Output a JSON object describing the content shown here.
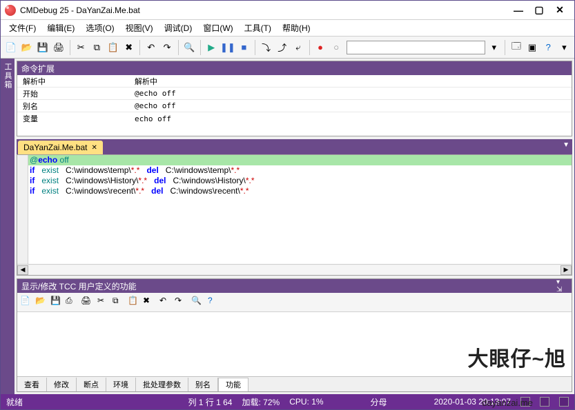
{
  "app": {
    "title": "CMDebug 25 - DaYanZai.Me.bat"
  },
  "menu": {
    "file": "文件(F)",
    "edit": "编辑(E)",
    "options": "选项(O)",
    "view": "视图(V)",
    "debug": "调试(D)",
    "window": "窗口(W)",
    "tools": "工具(T)",
    "help": "帮助(H)"
  },
  "toolbox_tab": "工具箱",
  "cmd_panel": {
    "title": "命令扩展",
    "rows": [
      {
        "k": "解析中",
        "v": "解析中"
      },
      {
        "k": "开始",
        "v": "@echo off"
      },
      {
        "k": "别名",
        "v": "@echo off"
      },
      {
        "k": "变量",
        "v": "echo off"
      }
    ]
  },
  "file_tab": {
    "name": "DaYanZai.Me.bat"
  },
  "code_lines": [
    {
      "hl": true,
      "tokens": [
        {
          "t": "@",
          "c": "kw-teal"
        },
        {
          "t": "echo",
          "c": "kw-blue"
        },
        {
          "t": " off",
          "c": "kw-teal"
        }
      ]
    },
    {
      "tokens": [
        {
          "t": "if",
          "c": "kw-blue"
        },
        {
          "t": "   ",
          "c": ""
        },
        {
          "t": "exist",
          "c": "kw-teal"
        },
        {
          "t": "   C:\\windows\\temp\\",
          "c": "str"
        },
        {
          "t": "*.*",
          "c": "kw-red"
        },
        {
          "t": "   ",
          "c": ""
        },
        {
          "t": "del",
          "c": "kw-blue"
        },
        {
          "t": "   C:\\windows\\temp\\",
          "c": "str"
        },
        {
          "t": "*.*",
          "c": "kw-red"
        }
      ]
    },
    {
      "tokens": [
        {
          "t": "if",
          "c": "kw-blue"
        },
        {
          "t": "   ",
          "c": ""
        },
        {
          "t": "exist",
          "c": "kw-teal"
        },
        {
          "t": "   C:\\windows\\History\\",
          "c": "str"
        },
        {
          "t": "*.*",
          "c": "kw-red"
        },
        {
          "t": "   ",
          "c": ""
        },
        {
          "t": "del",
          "c": "kw-blue"
        },
        {
          "t": "   C:\\windows\\History\\",
          "c": "str"
        },
        {
          "t": "*.*",
          "c": "kw-red"
        }
      ]
    },
    {
      "tokens": [
        {
          "t": "if",
          "c": "kw-blue"
        },
        {
          "t": "   ",
          "c": ""
        },
        {
          "t": "exist",
          "c": "kw-teal"
        },
        {
          "t": "   C:\\windows\\recent\\",
          "c": "str"
        },
        {
          "t": "*.*",
          "c": "kw-red"
        },
        {
          "t": "   ",
          "c": ""
        },
        {
          "t": "del",
          "c": "kw-blue"
        },
        {
          "t": "   C:\\windows\\recent\\",
          "c": "str"
        },
        {
          "t": "*.*",
          "c": "kw-red"
        }
      ]
    }
  ],
  "func_panel": {
    "title": "显示/修改 TCC 用户定义的功能",
    "watermark": "大眼仔~旭",
    "watermark_sub": "dayanzai.me"
  },
  "bottom_tabs": {
    "t1": "查看",
    "t2": "修改",
    "t3": "断点",
    "t4": "环境",
    "t5": "批处理参数",
    "t6": "别名",
    "t7": "功能"
  },
  "status": {
    "ready": "就绪",
    "pos": "列 1  行 1  64",
    "load": "加载:  72%",
    "cpu": "CPU:   1%",
    "mins": "分母",
    "time": "2020-01-03   20:13:07"
  }
}
